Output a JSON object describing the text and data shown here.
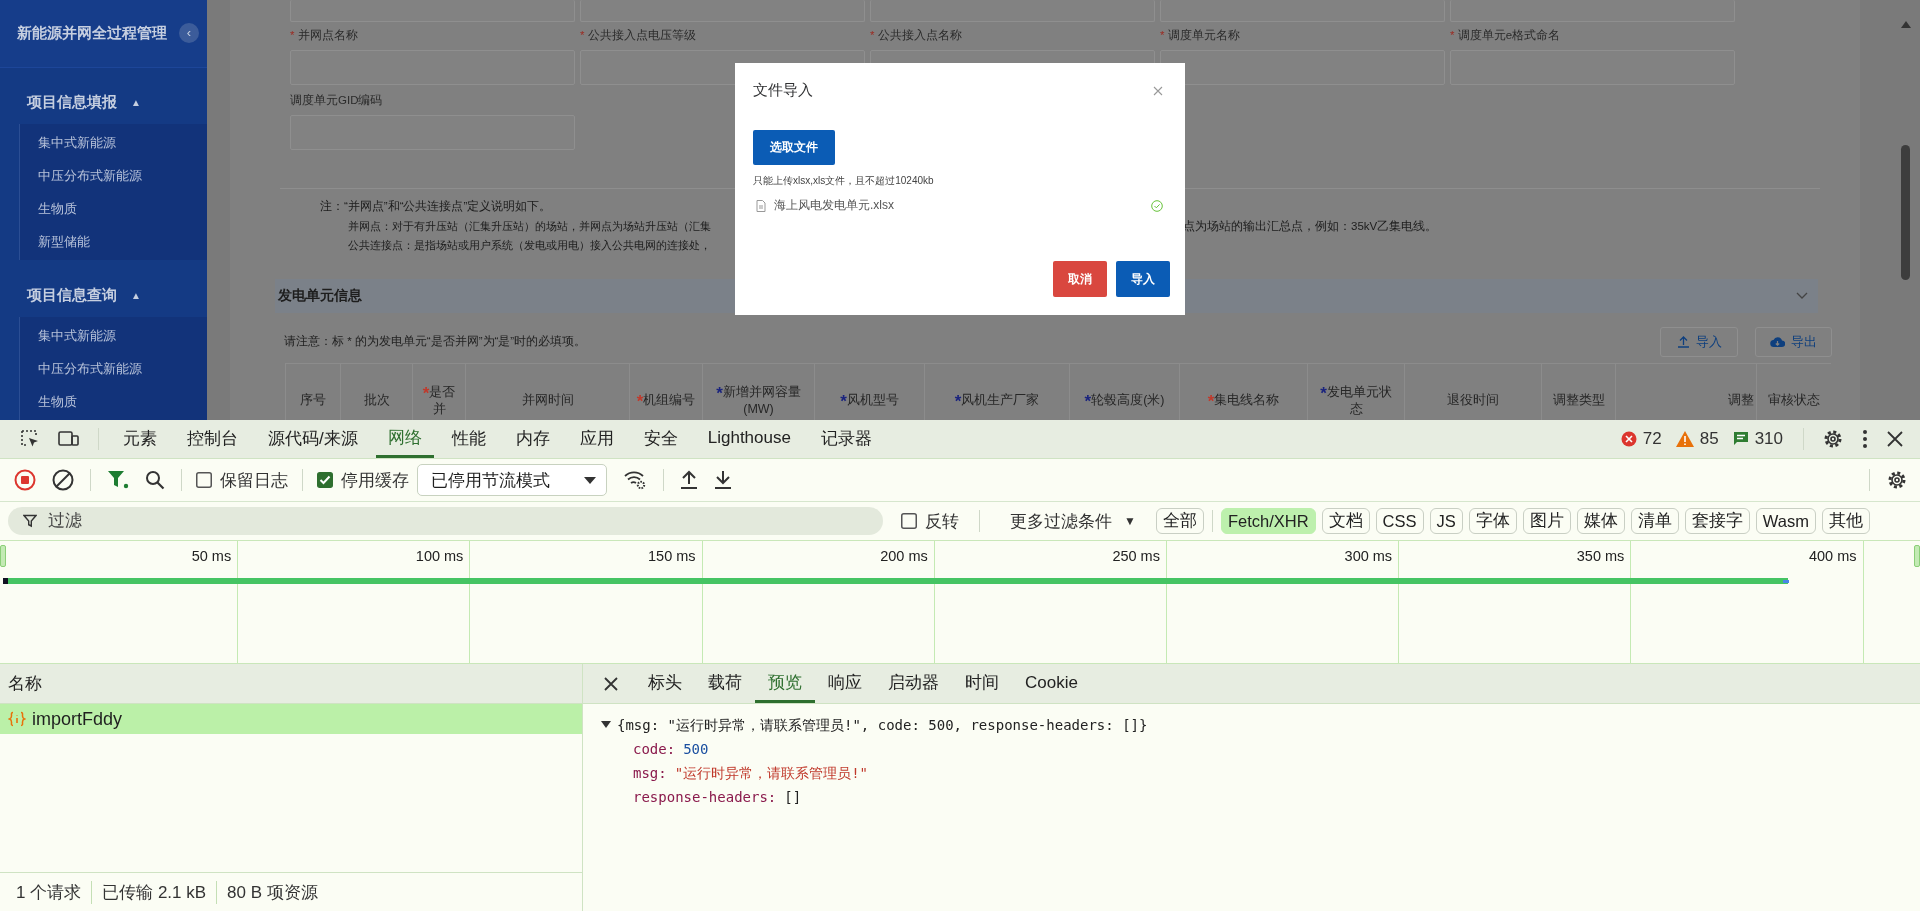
{
  "sidebar": {
    "title": "新能源并网全过程管理",
    "collapse_icon": "‹",
    "groups": [
      {
        "label": "项目信息填报",
        "arrow": "▲",
        "expanded": true,
        "items": [
          "集中式新能源",
          "中压分布式新能源",
          "生物质",
          "新型储能"
        ]
      },
      {
        "label": "项目信息查询",
        "arrow": "▲",
        "expanded": true,
        "items": [
          "集中式新能源",
          "中压分布式新能源",
          "生物质"
        ]
      }
    ]
  },
  "form": {
    "fields": [
      {
        "mark": "*",
        "label": "并网点名称"
      },
      {
        "mark": "*",
        "label": "公共接入点电压等级"
      },
      {
        "mark": "*",
        "label": "公共接入点名称"
      },
      {
        "mark": "*",
        "label": "调度单元名称"
      },
      {
        "mark": "*",
        "label": "调度单元e格式命名"
      }
    ],
    "gid_field": {
      "label": "调度单元GID编码"
    }
  },
  "notes": {
    "intro": "注：“并网点”和“公共连接点”定义说明如下。",
    "lines": [
      {
        "left": "并网点：对于有升压站（汇集升压站）的场站，并网点为场站升压站（汇集",
        "right": "点为场站的输出汇总点，例如：35kV乙集电线。"
      },
      {
        "left": "公共连接点：是指场站或用户系统（发电或用电）接入公共电网的连接处，"
      }
    ]
  },
  "section": {
    "title": "发电单元信息"
  },
  "unit_note": "请注意：标 * 的为发电单元“是否并网”为“是”时的必填项。",
  "unit_buttons": [
    {
      "kind": "upload",
      "label": "导入"
    },
    {
      "kind": "download",
      "label": "导出"
    }
  ],
  "table": {
    "columns": [
      {
        "label": "序号"
      },
      {
        "label": "批次"
      },
      {
        "mark": "*",
        "color": "#c0392b",
        "label": "是否并"
      },
      {
        "label": "并网时间"
      },
      {
        "mark": "*",
        "color": "#c0392b",
        "label": "机组编号"
      },
      {
        "mark": "*",
        "color": "#1a237e",
        "label": "新增并网容量(MW)"
      },
      {
        "mark": "*",
        "color": "#1a237e",
        "label": "风机型号"
      },
      {
        "mark": "*",
        "color": "#1a237e",
        "label": "风机生产厂家"
      },
      {
        "mark": "*",
        "color": "#1a237e",
        "label": "轮毂高度(米)"
      },
      {
        "mark": "*",
        "color": "#c0392b",
        "label": "集电线名称"
      },
      {
        "mark": "*",
        "color": "#1a237e",
        "label": "发电单元状态"
      },
      {
        "label": "退役时间"
      },
      {
        "label": "调整类型"
      },
      {
        "label": "调整"
      },
      {
        "label": "审核状态"
      }
    ]
  },
  "modal": {
    "title": "文件导入",
    "pick_button": "选取文件",
    "hint": "只能上传xlsx,xls文件，且不超过10240kb",
    "files": [
      {
        "name": "海上风电发电单元.xlsx",
        "uploaded": true
      }
    ],
    "buttons": [
      {
        "kind": "cancel",
        "label": "取消"
      },
      {
        "kind": "confirm",
        "label": "导入"
      }
    ]
  },
  "devtools": {
    "tabs": [
      {
        "label": "元素",
        "selected": false
      },
      {
        "label": "控制台",
        "selected": false
      },
      {
        "label": "源代码/来源",
        "selected": false
      },
      {
        "label": "网络",
        "selected": true
      },
      {
        "label": "性能",
        "selected": false
      },
      {
        "label": "内存",
        "selected": false
      },
      {
        "label": "应用",
        "selected": false
      },
      {
        "label": "安全",
        "selected": false
      },
      {
        "label": "Lighthouse",
        "selected": false
      },
      {
        "label": "记录器",
        "selected": false
      }
    ],
    "counts": {
      "errors": "72",
      "warnings": "85",
      "messages": "310"
    },
    "toolbar": {
      "recording": true,
      "preserve_log": {
        "label": "保留日志",
        "checked": false
      },
      "disable_cache": {
        "label": "停用缓存",
        "checked": true
      },
      "throttling": "已停用节流模式"
    },
    "filter": {
      "placeholder": "过滤",
      "invert": {
        "label": "反转",
        "checked": false
      },
      "more_filters": "更多过滤条件",
      "more_filters_arrow": "▼",
      "types": [
        {
          "label": "全部",
          "selected": false
        },
        {
          "label": "Fetch/XHR",
          "selected": true
        },
        {
          "label": "文档",
          "selected": false
        },
        {
          "label": "CSS",
          "selected": false
        },
        {
          "label": "JS",
          "selected": false
        },
        {
          "label": "字体",
          "selected": false
        },
        {
          "label": "图片",
          "selected": false
        },
        {
          "label": "媒体",
          "selected": false
        },
        {
          "label": "清单",
          "selected": false
        },
        {
          "label": "套接字",
          "selected": false
        },
        {
          "label": "Wasm",
          "selected": false
        },
        {
          "label": "其他",
          "selected": false
        }
      ]
    },
    "timeline": {
      "ticks": [
        "50 ms",
        "100 ms",
        "150 ms",
        "200 ms",
        "250 ms",
        "300 ms",
        "350 ms",
        "400 ms"
      ]
    },
    "requests": {
      "header": "名称",
      "rows": [
        {
          "name": "importFddy",
          "selected": true
        }
      ]
    },
    "status": [
      "1 个请求",
      "已传输 2.1 kB",
      "80 B 项资源"
    ],
    "detail": {
      "tabs": [
        {
          "label": "标头",
          "selected": false
        },
        {
          "label": "载荷",
          "selected": false
        },
        {
          "label": "预览",
          "selected": true
        },
        {
          "label": "响应",
          "selected": false
        },
        {
          "label": "启动器",
          "selected": false
        },
        {
          "label": "时间",
          "selected": false
        },
        {
          "label": "Cookie",
          "selected": false
        }
      ],
      "preview": {
        "summary": "{msg: \"运行时异常，请联系管理员!\", code: 500, response-headers: []}",
        "expanded": true,
        "properties": [
          {
            "key": "code:",
            "value": "500",
            "kind": "number"
          },
          {
            "key": "msg:",
            "value": "\"运行时异常，请联系管理员!\"",
            "kind": "string"
          },
          {
            "key": "response-headers:",
            "value": "[]",
            "kind": "array"
          }
        ]
      }
    }
  }
}
